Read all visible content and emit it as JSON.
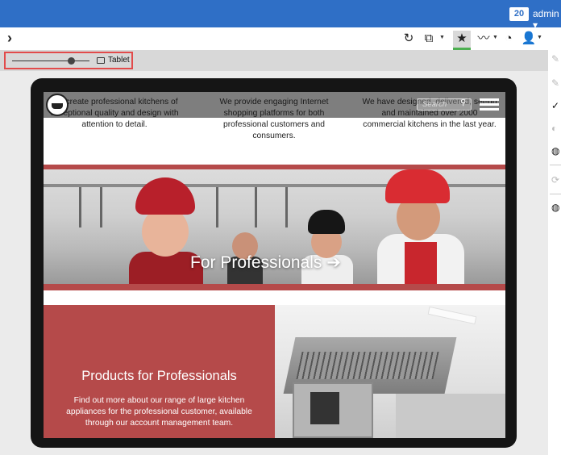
{
  "header": {
    "badge_count": "20",
    "user_label": "admin"
  },
  "toolbar": {
    "expand_icon": "chevron-right-icon",
    "icons": [
      "refresh-icon",
      "external-link-icon",
      "star-icon",
      "chart-icon",
      "history-icon",
      "user-icon"
    ]
  },
  "device_bar": {
    "device_label": "Tablet",
    "zoom_level": 0.77
  },
  "site": {
    "search_placeholder": "Search",
    "intro_columns": [
      "We create professional kitchens of exceptional quality and design with attention to detail.",
      "We provide engaging Internet shopping platforms for both professional customers and consumers.",
      "We have designed, delivered, set-up and maintained over 2000 commercial kitchens in the last year."
    ],
    "hero_title": "For Professionals ➔",
    "card_title": "Products for Professionals",
    "card_text": "Find out more about our range of large kitchen appliances for the professional customer, available through our account management team."
  },
  "colors": {
    "topbar": "#2f6fc6",
    "accent_red": "#b54a4a",
    "active_underline": "#4caf50",
    "highlight_border": "#e24b4b"
  }
}
